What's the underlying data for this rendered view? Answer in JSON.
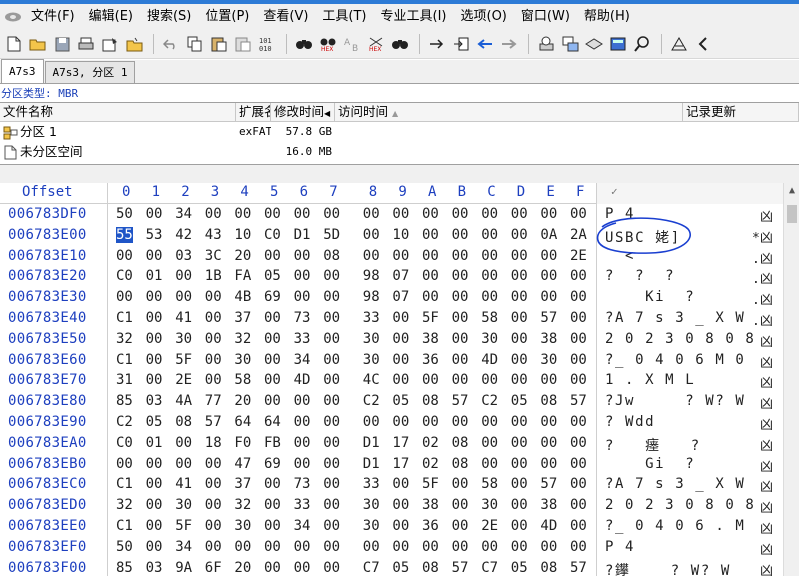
{
  "menubar": {
    "items": [
      "文件(F)",
      "编辑(E)",
      "搜索(S)",
      "位置(P)",
      "查看(V)",
      "工具(T)",
      "专业工具(I)",
      "选项(O)",
      "窗口(W)",
      "帮助(H)"
    ]
  },
  "toolbar": {
    "icons": [
      "new-icon",
      "open-icon",
      "save-icon",
      "print-icon",
      "properties-icon",
      "open-disk-icon",
      "undo-icon",
      "copy-icon",
      "paste-icon",
      "paste-special-icon",
      "convert-icon",
      "find-text-icon",
      "find-hex-icon",
      "replace-text-icon",
      "replace-hex-icon",
      "find-again-icon",
      "goto-offset-icon",
      "goto-sector-icon",
      "back-icon",
      "forward-icon",
      "disk-tools-icon",
      "data-interpreter-icon",
      "template-icon",
      "calculator-icon",
      "search-magnifier-icon",
      "bookmark-icon",
      "next-icon"
    ]
  },
  "tabs": [
    {
      "label": "A7s3",
      "active": true
    },
    {
      "label": "A7s3, 分区 1",
      "active": false
    }
  ],
  "partition_type": {
    "label": "分区类型:",
    "value": "MBR"
  },
  "file_list": {
    "headers": {
      "name": "文件名称",
      "ext": "扩展名",
      "modified": "修改时间",
      "accessed": "访问时间",
      "record": "记录更新"
    },
    "rows": [
      {
        "name": "分区 1",
        "ext": "exFAT",
        "size": "57.8 GB",
        "icon": "partition-icon"
      },
      {
        "name": "未分区空间",
        "ext": "",
        "size": "16.0 MB",
        "icon": "blank-file-icon"
      }
    ]
  },
  "hex": {
    "offset_label": "Offset",
    "columns": [
      "0",
      "1",
      "2",
      "3",
      "4",
      "5",
      "6",
      "7",
      "8",
      "9",
      "A",
      "B",
      "C",
      "D",
      "E",
      "F"
    ],
    "rows": [
      {
        "offset": "006783DF0",
        "bytes": [
          "50",
          "00",
          "34",
          "00",
          "00",
          "00",
          "00",
          "00",
          "00",
          "00",
          "00",
          "00",
          "00",
          "00",
          "00",
          "00"
        ],
        "ascii": "P 4",
        "edge": "凶"
      },
      {
        "offset": "006783E00",
        "bytes": [
          "55",
          "53",
          "42",
          "43",
          "10",
          "C0",
          "D1",
          "5D",
          "00",
          "10",
          "00",
          "00",
          "00",
          "00",
          "0A",
          "2A"
        ],
        "ascii": "USBC 姥]",
        "edge": "*凶"
      },
      {
        "offset": "006783E10",
        "bytes": [
          "00",
          "00",
          "03",
          "3C",
          "20",
          "00",
          "00",
          "08",
          "00",
          "00",
          "00",
          "00",
          "00",
          "00",
          "00",
          "2E"
        ],
        "ascii": "  <",
        "edge": ".凶"
      },
      {
        "offset": "006783E20",
        "bytes": [
          "C0",
          "01",
          "00",
          "1B",
          "FA",
          "05",
          "00",
          "00",
          "98",
          "07",
          "00",
          "00",
          "00",
          "00",
          "00",
          "00"
        ],
        "ascii": "?  ?  ?",
        "edge": ".凶"
      },
      {
        "offset": "006783E30",
        "bytes": [
          "00",
          "00",
          "00",
          "00",
          "4B",
          "69",
          "00",
          "00",
          "98",
          "07",
          "00",
          "00",
          "00",
          "00",
          "00",
          "00"
        ],
        "ascii": "    Ki  ?",
        "edge": ".凶"
      },
      {
        "offset": "006783E40",
        "bytes": [
          "C1",
          "00",
          "41",
          "00",
          "37",
          "00",
          "73",
          "00",
          "33",
          "00",
          "5F",
          "00",
          "58",
          "00",
          "57",
          "00"
        ],
        "ascii": "?A 7 s 3 _ X W",
        "edge": ".凶"
      },
      {
        "offset": "006783E50",
        "bytes": [
          "32",
          "00",
          "30",
          "00",
          "32",
          "00",
          "33",
          "00",
          "30",
          "00",
          "38",
          "00",
          "30",
          "00",
          "38",
          "00"
        ],
        "ascii": "2 0 2 3 0 8 0 8",
        "edge": "凶"
      },
      {
        "offset": "006783E60",
        "bytes": [
          "C1",
          "00",
          "5F",
          "00",
          "30",
          "00",
          "34",
          "00",
          "30",
          "00",
          "36",
          "00",
          "4D",
          "00",
          "30",
          "00"
        ],
        "ascii": "?_ 0 4 0 6 M 0",
        "edge": "凶"
      },
      {
        "offset": "006783E70",
        "bytes": [
          "31",
          "00",
          "2E",
          "00",
          "58",
          "00",
          "4D",
          "00",
          "4C",
          "00",
          "00",
          "00",
          "00",
          "00",
          "00",
          "00"
        ],
        "ascii": "1 . X M L",
        "edge": "凶"
      },
      {
        "offset": "006783E80",
        "bytes": [
          "85",
          "03",
          "4A",
          "77",
          "20",
          "00",
          "00",
          "00",
          "C2",
          "05",
          "08",
          "57",
          "C2",
          "05",
          "08",
          "57"
        ],
        "ascii": "?Jw     ? W? W",
        "edge": "凶"
      },
      {
        "offset": "006783E90",
        "bytes": [
          "C2",
          "05",
          "08",
          "57",
          "64",
          "64",
          "00",
          "00",
          "00",
          "00",
          "00",
          "00",
          "00",
          "00",
          "00",
          "00"
        ],
        "ascii": "? Wdd",
        "edge": "凶"
      },
      {
        "offset": "006783EA0",
        "bytes": [
          "C0",
          "01",
          "00",
          "18",
          "F0",
          "FB",
          "00",
          "00",
          "D1",
          "17",
          "02",
          "08",
          "00",
          "00",
          "00",
          "00"
        ],
        "ascii": "?   瘗   ?",
        "edge": "凶"
      },
      {
        "offset": "006783EB0",
        "bytes": [
          "00",
          "00",
          "00",
          "00",
          "47",
          "69",
          "00",
          "00",
          "D1",
          "17",
          "02",
          "08",
          "00",
          "00",
          "00",
          "00"
        ],
        "ascii": "    Gi  ?",
        "edge": "凶"
      },
      {
        "offset": "006783EC0",
        "bytes": [
          "C1",
          "00",
          "41",
          "00",
          "37",
          "00",
          "73",
          "00",
          "33",
          "00",
          "5F",
          "00",
          "58",
          "00",
          "57",
          "00"
        ],
        "ascii": "?A 7 s 3 _ X W",
        "edge": "凶"
      },
      {
        "offset": "006783ED0",
        "bytes": [
          "32",
          "00",
          "30",
          "00",
          "32",
          "00",
          "33",
          "00",
          "30",
          "00",
          "38",
          "00",
          "30",
          "00",
          "38",
          "00"
        ],
        "ascii": "2 0 2 3 0 8 0 8",
        "edge": "凶"
      },
      {
        "offset": "006783EE0",
        "bytes": [
          "C1",
          "00",
          "5F",
          "00",
          "30",
          "00",
          "34",
          "00",
          "30",
          "00",
          "36",
          "00",
          "2E",
          "00",
          "4D",
          "00"
        ],
        "ascii": "?_ 0 4 0 6 . M",
        "edge": "凶"
      },
      {
        "offset": "006783EF0",
        "bytes": [
          "50",
          "00",
          "34",
          "00",
          "00",
          "00",
          "00",
          "00",
          "00",
          "00",
          "00",
          "00",
          "00",
          "00",
          "00",
          "00"
        ],
        "ascii": "P 4",
        "edge": "凶"
      },
      {
        "offset": "006783F00",
        "bytes": [
          "85",
          "03",
          "9A",
          "6F",
          "20",
          "00",
          "00",
          "00",
          "C7",
          "05",
          "08",
          "57",
          "C7",
          "05",
          "08",
          "57"
        ],
        "ascii": "?鑻    ? W? W",
        "edge": "凶"
      }
    ]
  },
  "colors": {
    "offset_blue": "#1d3fbf",
    "selection": "#1f55c7",
    "annotation_circle": "#1a3fd0"
  }
}
